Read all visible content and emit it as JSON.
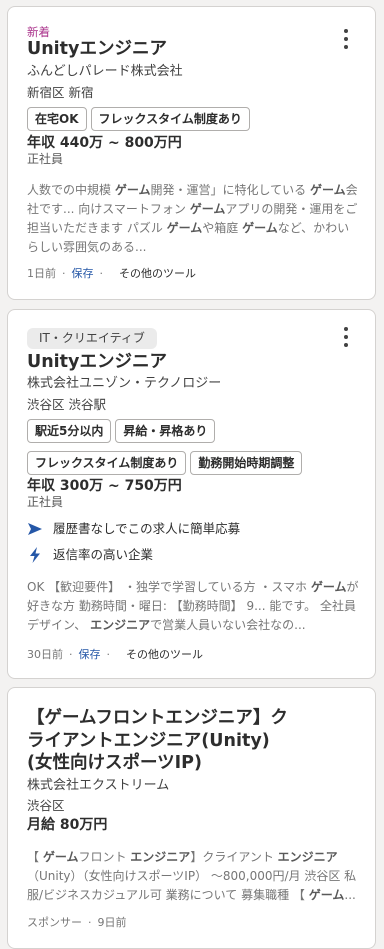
{
  "cards": [
    {
      "new_label": "新着",
      "title": "Unityエンジニア",
      "company": "ふんどしパレード株式会社",
      "location": "新宿区 新宿",
      "tags": [
        "在宅OK",
        "フレックスタイム制度あり"
      ],
      "salary": "年収 440万 ~ 800万円",
      "employment_type": "正社員",
      "snippet": [
        {
          "t": "人数での中規模 ",
          "b": false
        },
        {
          "t": "ゲーム",
          "b": true
        },
        {
          "t": "開発・運営」に特化している ",
          "b": false
        },
        {
          "t": "ゲーム",
          "b": true
        },
        {
          "t": "会社です... 向けスマートフォン ",
          "b": false
        },
        {
          "t": "ゲーム",
          "b": true
        },
        {
          "t": "アプリの開発・運用をご担当いただきます パズル ",
          "b": false
        },
        {
          "t": "ゲーム",
          "b": true
        },
        {
          "t": "や箱庭 ",
          "b": false
        },
        {
          "t": "ゲーム",
          "b": true
        },
        {
          "t": "など、かわいらしい雰囲気のある...",
          "b": false
        }
      ],
      "posted": "1日前",
      "save": "保存",
      "tools": "その他のツール"
    },
    {
      "category": "IT・クリエイティブ",
      "title": "Unityエンジニア",
      "company": "株式会社ユニゾン・テクノロジー",
      "location": "渋谷区 渋谷駅",
      "tags_row1": [
        "駅近5分以内",
        "昇給・昇格あり"
      ],
      "tags_row2": [
        "フレックスタイム制度あり",
        "勤務開始時期調整"
      ],
      "salary": "年収 300万 ~ 750万円",
      "employment_type": "正社員",
      "features": [
        {
          "icon": "send-arrow-icon",
          "text": "履歴書なしでこの求人に簡単応募"
        },
        {
          "icon": "lightning-icon",
          "text": "返信率の高い企業"
        }
      ],
      "snippet": [
        {
          "t": "OK 【歓迎要件】 ・独学で学習している方 ・スマホ ",
          "b": false
        },
        {
          "t": "ゲーム",
          "b": true
        },
        {
          "t": "が好きな方 勤務時間・曜日: 【勤務時間】 9... 能です。 全社員デザイン、 ",
          "b": false
        },
        {
          "t": "エンジニア",
          "b": true
        },
        {
          "t": "で営業人員いない会社なの...",
          "b": false
        }
      ],
      "posted": "30日前",
      "save": "保存",
      "tools": "その他のツール"
    },
    {
      "title": "【ゲームフロントエンジニア】クライアントエンジニア(Unity)(女性向けスポーツIP)",
      "company": "株式会社エクストリーム",
      "location": "渋谷区",
      "salary": "月給 80万円",
      "snippet": [
        {
          "t": "【 ",
          "b": false
        },
        {
          "t": "ゲーム",
          "b": true
        },
        {
          "t": "フロント ",
          "b": false
        },
        {
          "t": "エンジニア",
          "b": true
        },
        {
          "t": "】クライアント ",
          "b": false
        },
        {
          "t": "エンジニア",
          "b": true
        },
        {
          "t": "（Unity）（女性向けスポーツIP） 〜800,000円/月 渋谷区 私服/ビジネスカジュアル可 業務について 募集職種 【 ",
          "b": false
        },
        {
          "t": "ゲーム",
          "b": true
        },
        {
          "t": "...",
          "b": false
        }
      ],
      "sponsored": "スポンサー",
      "posted": "9日前"
    }
  ]
}
